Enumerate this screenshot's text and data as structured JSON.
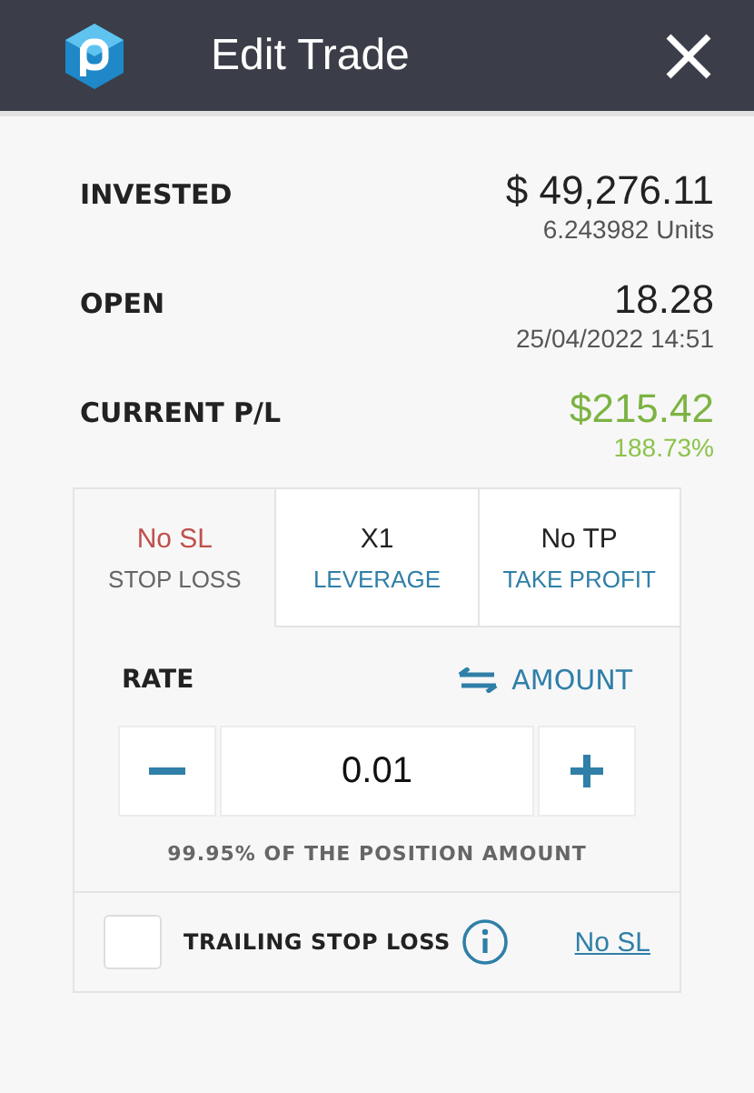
{
  "header": {
    "title": "Edit Trade"
  },
  "summary": [
    {
      "label": "INVESTED",
      "value": "$ 49,276.11",
      "sub": "6.243982 Units",
      "kind": "plain"
    },
    {
      "label": "OPEN",
      "value": "18.28",
      "sub": "25/04/2022 14:51",
      "kind": "plain"
    },
    {
      "label": "CURRENT P/L",
      "value": "$215.42",
      "sub": "188.73%",
      "kind": "gain"
    }
  ],
  "tabs": [
    {
      "value": "No SL",
      "label": "STOP LOSS",
      "selected": true
    },
    {
      "value": "X1",
      "label": "LEVERAGE",
      "selected": false
    },
    {
      "value": "No TP",
      "label": "TAKE PROFIT",
      "selected": false
    }
  ],
  "rate": {
    "label": "RATE",
    "switch": "AMOUNT",
    "value": "0.01",
    "note": "99.95% OF THE POSITION AMOUNT"
  },
  "trailing": {
    "label": "TRAILING STOP LOSS",
    "checked": false,
    "link": "No SL"
  }
}
